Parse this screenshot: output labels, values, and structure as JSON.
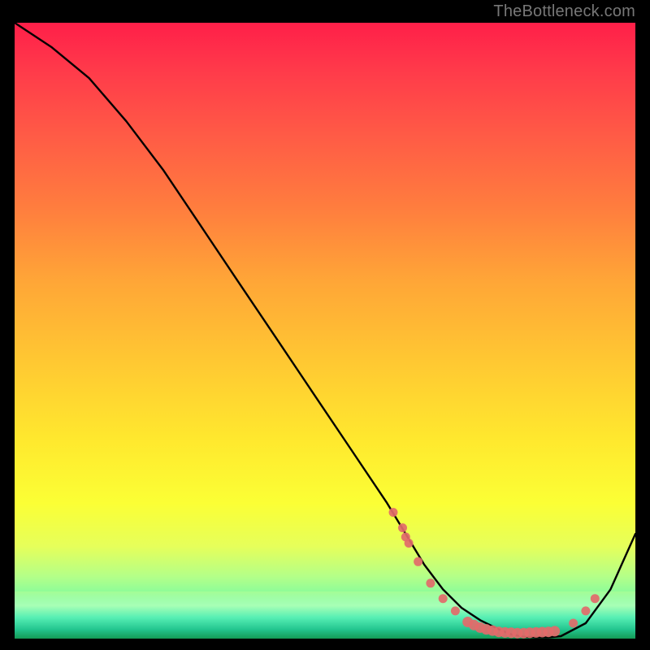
{
  "watermark": "TheBottleneck.com",
  "chart_data": {
    "type": "line",
    "title": "",
    "xlabel": "",
    "ylabel": "",
    "xlim": [
      0,
      100
    ],
    "ylim": [
      0,
      100
    ],
    "legend": false,
    "curve": {
      "name": "bottleneck-curve",
      "color": "#000000",
      "x": [
        0,
        6,
        12,
        18,
        24,
        30,
        36,
        42,
        48,
        54,
        60,
        63,
        66,
        69,
        72,
        75,
        78,
        80,
        82,
        84,
        86,
        88,
        92,
        96,
        100
      ],
      "y": [
        100,
        96,
        91,
        84,
        76,
        67,
        58,
        49,
        40,
        31,
        22,
        17,
        12,
        8,
        5,
        3,
        1.5,
        0.7,
        0.3,
        0.2,
        0.2,
        0.4,
        2.5,
        8,
        17
      ]
    },
    "highlight_cluster": {
      "name": "optimal-range-markers",
      "color": "#e26a6a",
      "points_xy": [
        [
          61,
          20.5
        ],
        [
          62.5,
          18
        ],
        [
          63,
          16.5
        ],
        [
          63.5,
          15.5
        ],
        [
          65,
          12.5
        ],
        [
          67,
          9
        ],
        [
          69,
          6.5
        ],
        [
          71,
          4.5
        ],
        [
          73,
          2.7
        ],
        [
          74,
          2.2
        ],
        [
          75,
          1.8
        ],
        [
          76,
          1.5
        ],
        [
          77,
          1.3
        ],
        [
          78,
          1.1
        ],
        [
          79,
          1.0
        ],
        [
          80,
          0.95
        ],
        [
          81,
          0.9
        ],
        [
          82,
          0.9
        ],
        [
          83,
          0.95
        ],
        [
          84,
          1.0
        ],
        [
          85,
          1.05
        ],
        [
          86,
          1.1
        ],
        [
          87,
          1.2
        ],
        [
          90,
          2.5
        ],
        [
          92,
          4.5
        ],
        [
          93.5,
          6.5
        ]
      ],
      "dense_band_x": [
        72,
        88
      ]
    }
  }
}
